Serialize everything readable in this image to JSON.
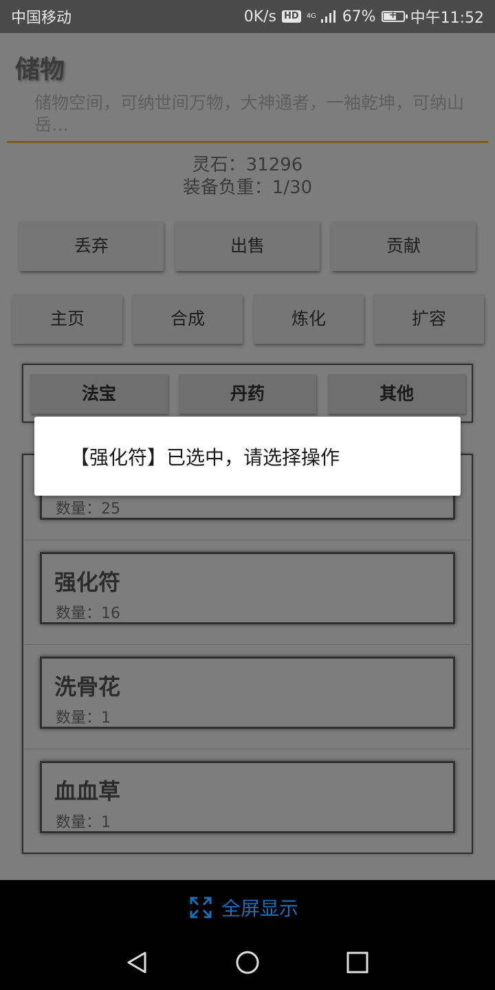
{
  "status_bar": {
    "carrier": "中国移动",
    "speed": "0K/s",
    "hd": "HD",
    "network": "4G",
    "battery_pct": "67%",
    "battery_level": 0.67,
    "time": "中午11:52"
  },
  "page": {
    "title": "储物",
    "description": "储物空间，可纳世间万物，大神通者，一袖乾坤，可纳山岳…",
    "spirit_stone": "灵石：31296",
    "load": "装备负重：1/30"
  },
  "actions_row1": [
    "丢弃",
    "出售",
    "贡献"
  ],
  "actions_row2": [
    "主页",
    "合成",
    "炼化",
    "扩容"
  ],
  "categories": [
    "法宝",
    "丹药",
    "其他"
  ],
  "items": [
    {
      "name": "",
      "qty": "数量：25"
    },
    {
      "name": "强化符",
      "qty": "数量：16"
    },
    {
      "name": "洗骨花",
      "qty": "数量：1"
    },
    {
      "name": "血血草",
      "qty": "数量：1"
    }
  ],
  "dialog": {
    "message": "【强化符】已选中，请选择操作"
  },
  "fullscreen": {
    "label": "全屏显示"
  },
  "colors": {
    "accent_underline": "#7a5e14",
    "fullscreen_blue": "#1f6fb5"
  }
}
